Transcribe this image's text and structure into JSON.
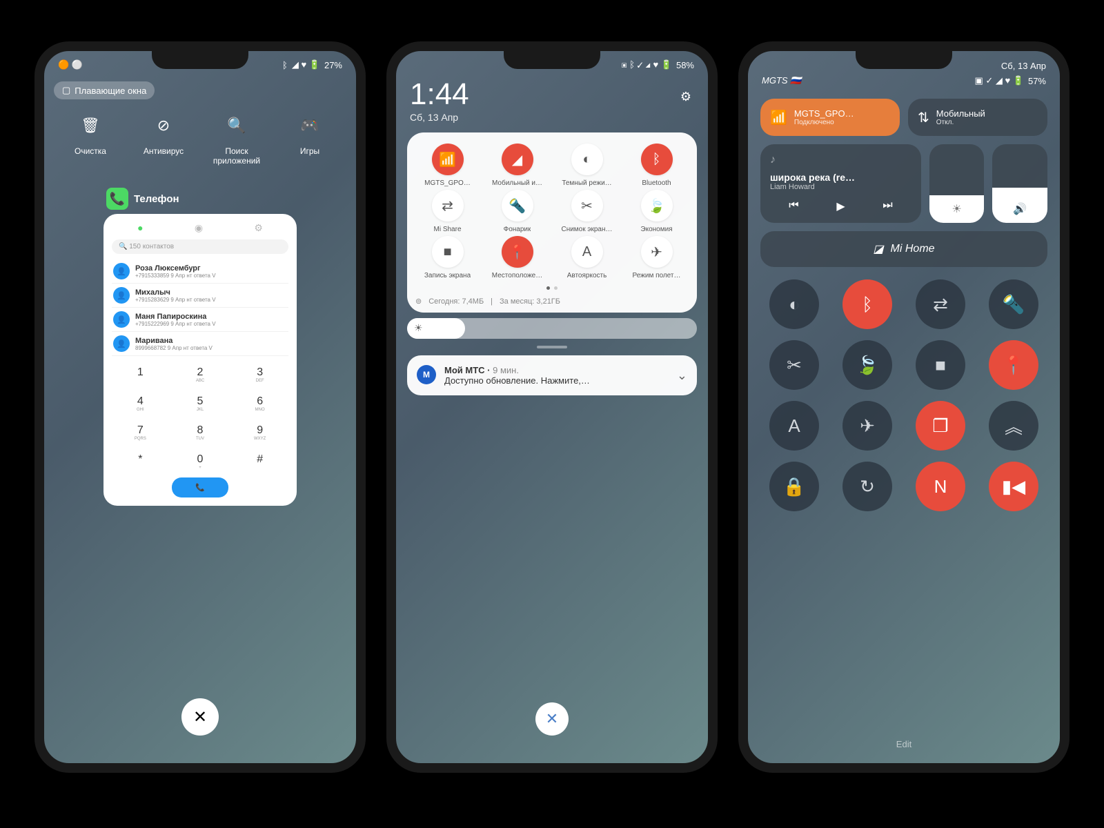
{
  "phone1": {
    "status": {
      "battery": "27%"
    },
    "floating_windows": "Плавающие окна",
    "toprow": [
      {
        "icon": "🗑",
        "label": "Очистка"
      },
      {
        "icon": "⊘",
        "label": "Антивирус"
      },
      {
        "icon": "🔍",
        "label": "Поиск приложений"
      },
      {
        "icon": "🎮",
        "label": "Игры"
      }
    ],
    "app_label": "Телефон",
    "search_placeholder": "🔍 150 контактов",
    "contacts": [
      {
        "name": "Роза Люксембург",
        "meta": "+7915333859 9 Апр нт ответа V"
      },
      {
        "name": "Михалыч",
        "meta": "+7915283629 9 Апр нт ответа V"
      },
      {
        "name": "Маня Папироскина",
        "meta": "+7915222969 9 Апр нт ответа V"
      },
      {
        "name": "Маривана",
        "meta": "8999668782 9 Апр нт ответа V"
      }
    ],
    "keys": [
      {
        "n": "1",
        "l": ""
      },
      {
        "n": "2",
        "l": "ABC"
      },
      {
        "n": "3",
        "l": "DEF"
      },
      {
        "n": "4",
        "l": "GHI"
      },
      {
        "n": "5",
        "l": "JKL"
      },
      {
        "n": "6",
        "l": "MNO"
      },
      {
        "n": "7",
        "l": "PQRS"
      },
      {
        "n": "8",
        "l": "TUV"
      },
      {
        "n": "9",
        "l": "WXYZ"
      },
      {
        "n": "*",
        "l": ""
      },
      {
        "n": "0",
        "l": "+"
      },
      {
        "n": "#",
        "l": ""
      }
    ]
  },
  "phone2": {
    "time": "1:44",
    "date": "Сб, 13 Апр",
    "battery": "58%",
    "toggles": [
      {
        "icon": "📶",
        "label": "MGTS_GPO…",
        "on": true
      },
      {
        "icon": "◢",
        "label": "Мобильный и…",
        "on": true
      },
      {
        "icon": "◐",
        "label": "Темный режи…",
        "on": false
      },
      {
        "icon": "ᛒ",
        "label": "Bluetooth",
        "on": true
      },
      {
        "icon": "⇄",
        "label": "Mi Share",
        "on": false
      },
      {
        "icon": "🔦",
        "label": "Фонарик",
        "on": false
      },
      {
        "icon": "✂",
        "label": "Снимок экран…",
        "on": false
      },
      {
        "icon": "🍃",
        "label": "Экономия",
        "on": false
      },
      {
        "icon": "■",
        "label": "Запись экрана",
        "on": false
      },
      {
        "icon": "📍",
        "label": "Местоположе…",
        "on": true
      },
      {
        "icon": "A",
        "label": "Автояркость",
        "on": false
      },
      {
        "icon": "✈",
        "label": "Режим полет…",
        "on": false
      }
    ],
    "data_today": "Сегодня: 7,4МБ",
    "data_month": "За месяц: 3,21ГБ",
    "notif": {
      "title": "Мой МТС",
      "time": "9 мин.",
      "body": "Доступно обновление. Нажмите,…"
    }
  },
  "phone3": {
    "carrier": "MGTS",
    "date": "Сб, 13 Апр",
    "battery": "57%",
    "wifi": {
      "name": "MGTS_GPO…",
      "sub": "Подключено"
    },
    "mobile": {
      "name": "Мобильный",
      "sub": "Откл."
    },
    "media": {
      "song": "широка река (re…",
      "artist": "Liam Howard"
    },
    "mihome": "Mi Home",
    "grid": [
      {
        "icon": "◐",
        "red": false
      },
      {
        "icon": "ᛒ",
        "red": true
      },
      {
        "icon": "⇄",
        "red": false
      },
      {
        "icon": "🔦",
        "red": false
      },
      {
        "icon": "✂",
        "red": false
      },
      {
        "icon": "🍃",
        "red": false
      },
      {
        "icon": "■",
        "red": false
      },
      {
        "icon": "📍",
        "red": true
      },
      {
        "icon": "A",
        "red": false
      },
      {
        "icon": "✈",
        "red": false
      },
      {
        "icon": "❐",
        "red": true
      },
      {
        "icon": "︽",
        "red": false
      },
      {
        "icon": "🔒",
        "red": false
      },
      {
        "icon": "↻",
        "red": false
      },
      {
        "icon": "N",
        "red": true
      },
      {
        "icon": "▮◀",
        "red": true
      }
    ],
    "edit": "Edit"
  }
}
